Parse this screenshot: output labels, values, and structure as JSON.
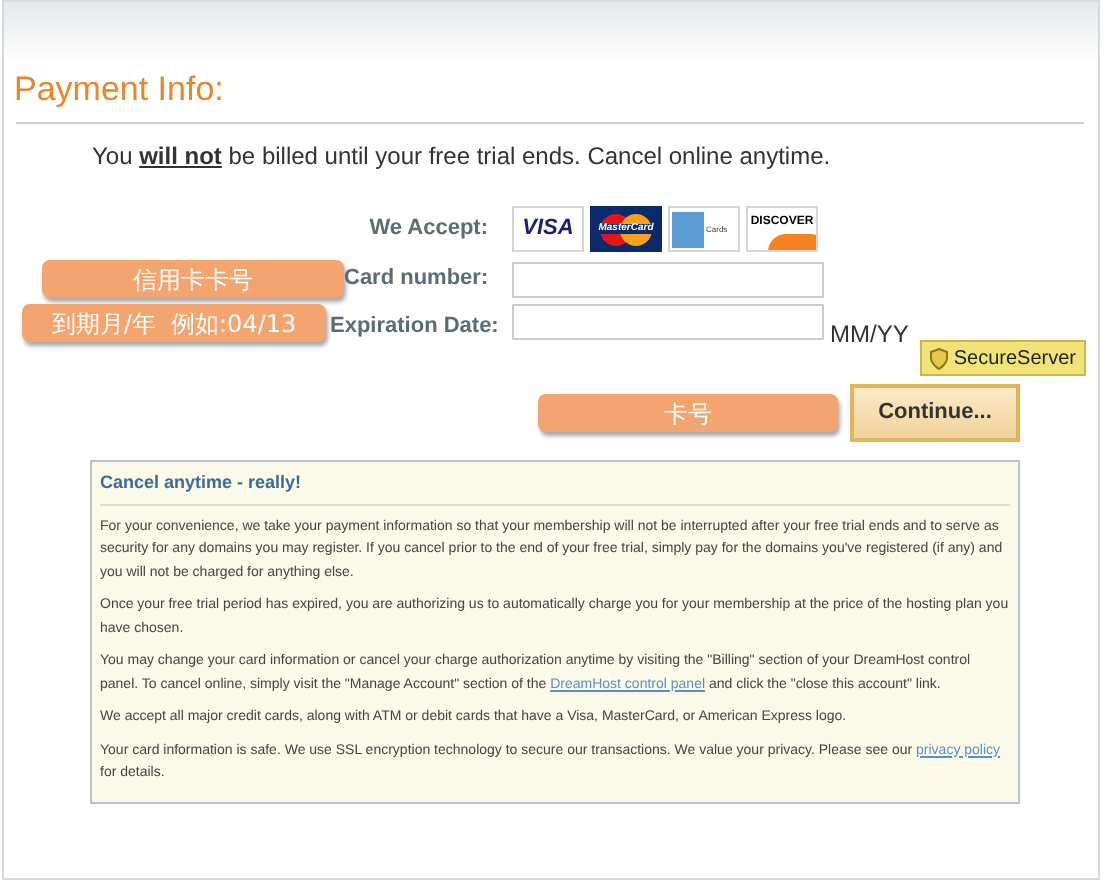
{
  "heading": "Payment Info:",
  "notice": "You **will not** be billed until your free trial ends. Cancel online anytime.",
  "accept_label": "We Accept:",
  "cards": [
    {
      "kind": "visa",
      "label": "VISA"
    },
    {
      "kind": "mastercard",
      "label": "MasterCard"
    },
    {
      "kind": "amex",
      "label": "Cards"
    },
    {
      "kind": "discover",
      "label": "DISCOVER"
    }
  ],
  "fields": [
    {
      "label": "Card number:",
      "annotation": "信用卡卡号"
    },
    {
      "label": "Expiration Date:",
      "annotation": "到期月/年  例如:04/13",
      "suffix": "MM/YY"
    }
  ],
  "secure_badge": "SecureServer",
  "button_annotation": "卡号",
  "continue_button": "Continue...",
  "info": {
    "title": "Cancel anytime - really!",
    "paragraphs": [
      {
        "parts": [
          {
            "text": "For your convenience, we take your payment information so that your membership will not be interrupted after your free trial ends and to serve as security for any domains you may register. If you cancel prior to the end of your free trial, simply pay for the domains you've registered (if any) and you will not be charged for anything else."
          }
        ]
      },
      {
        "parts": [
          {
            "text": "Once your free trial period has expired, you are authorizing us to automatically charge you for your membership at the price of the hosting plan you have chosen."
          }
        ]
      },
      {
        "parts": [
          {
            "text": "You may change your card information or cancel your charge authorization anytime by visiting the \"Billing\" section of your DreamHost control panel. To cancel online, simply visit the \"Manage Account\" section of the "
          },
          {
            "text": "DreamHost control panel",
            "link": true
          },
          {
            "text": " and click the \"close this account\" link."
          }
        ]
      },
      {
        "parts": [
          {
            "text": "We accept all major credit cards, along with ATM or debit cards that have a Visa, MasterCard, or American Express logo."
          }
        ]
      },
      {
        "parts": [
          {
            "text": "Your card information is safe. We use SSL encryption technology to secure our transactions. We value your privacy. Please see our "
          },
          {
            "text": "privacy policy",
            "link": true
          },
          {
            "text": " for details."
          }
        ]
      }
    ]
  }
}
